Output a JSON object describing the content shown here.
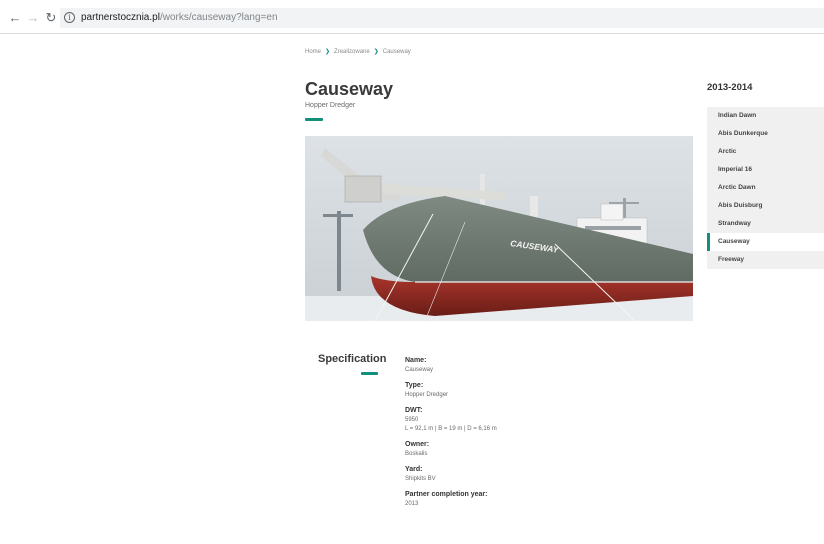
{
  "browser": {
    "url_host": "partnerstocznia.pl",
    "url_path": "/works/causeway?lang=en"
  },
  "breadcrumb": [
    "Home",
    "Zrealizowane",
    "Causeway"
  ],
  "page": {
    "title": "Causeway",
    "subtitle": "Hopper Dredger",
    "photo_hull_text": "CAUSEWAY"
  },
  "sidebar": {
    "year": "2013-2014",
    "items": [
      {
        "label": "Indian Dawn",
        "active": false
      },
      {
        "label": "Abis Dunkerque",
        "active": false
      },
      {
        "label": "Arctic",
        "active": false
      },
      {
        "label": "Imperial 16",
        "active": false
      },
      {
        "label": "Arctic Dawn",
        "active": false
      },
      {
        "label": "Abis Duisburg",
        "active": false
      },
      {
        "label": "Strandway",
        "active": false
      },
      {
        "label": "Causeway",
        "active": true
      },
      {
        "label": "Freeway",
        "active": false
      }
    ]
  },
  "spec": {
    "heading": "Specification",
    "items": [
      {
        "label": "Name:",
        "value": "Causeway"
      },
      {
        "label": "Type:",
        "value": "Hopper Dredger"
      },
      {
        "label": "DWT:",
        "value": "5950",
        "extra": "L = 92,1 m  |  B = 19 m  |  D = 6,16 m"
      },
      {
        "label": "Owner:",
        "value": "Boskalis"
      },
      {
        "label": "Yard:",
        "value": "Shipkits BV"
      },
      {
        "label": "Partner completion year:",
        "value": "2013"
      }
    ]
  },
  "colors": {
    "accent": "#13907c",
    "hull_red": "#8e2a22",
    "hull_grey": "#6f7a72"
  },
  "icons": {
    "back": "arrow-left",
    "forward": "arrow-right",
    "reload": "reload",
    "info": "info-circle",
    "breadcrumb_separator": "chevron-right"
  }
}
